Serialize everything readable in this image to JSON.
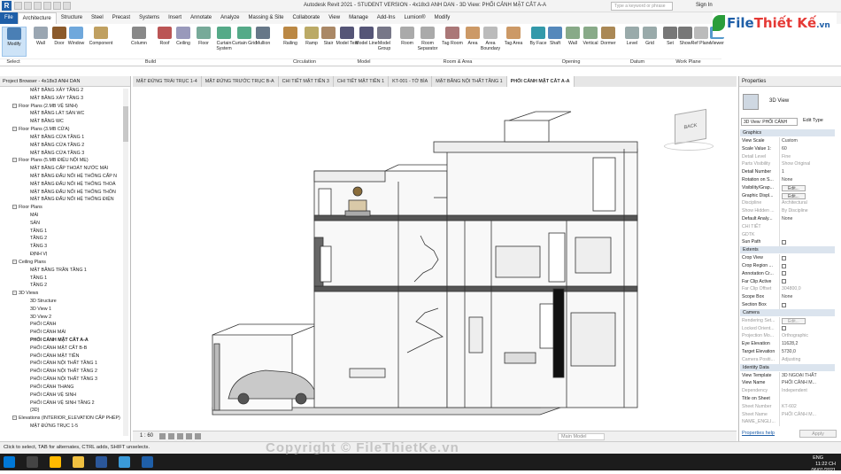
{
  "app": {
    "title": "Autodesk Revit 2021 - STUDENT VERSION - 4x18x3 ANH DAN - 3D View: PHỐI CẢNH MẶT CẮT A-A",
    "search_placeholder": "Type a keyword or phrase",
    "sign_in": "Sign In"
  },
  "ribbon_tabs": [
    "File",
    "Architecture",
    "Structure",
    "Steel",
    "Precast",
    "Systems",
    "Insert",
    "Annotate",
    "Analyze",
    "Massing & Site",
    "Collaborate",
    "View",
    "Manage",
    "Add-Ins",
    "Lumion®",
    "Modify"
  ],
  "ribbon_buttons": [
    "Modify",
    "Wall",
    "Door",
    "Window",
    "Component",
    "Column",
    "Roof",
    "Ceiling",
    "Floor",
    "Curtain System",
    "Curtain Grid",
    "Mullion",
    "Railing",
    "Ramp",
    "Stair",
    "Model Text",
    "Model Line",
    "Model Group",
    "Room",
    "Room Separator",
    "Tag Room",
    "Area",
    "Area Boundary",
    "Tag Area",
    "By Face",
    "Shaft",
    "Wall",
    "Vertical",
    "Dormer",
    "Level",
    "Grid",
    "Set",
    "Show",
    "Ref Plane",
    "Viewer"
  ],
  "ribbon_groups": [
    "Select",
    "Build",
    "Circulation",
    "Model",
    "Room & Area",
    "Opening",
    "Datum",
    "Work Plane"
  ],
  "logo": {
    "prefix": "File",
    "suffix": "Thiết Kế",
    "domain": ".vn"
  },
  "project_browser": {
    "title": "Project Browser - 4x18x3 ANH DAN",
    "items": [
      "MẶT BẰNG XÂY TẦNG 2",
      "MẶT BẰNG XÂY TẦNG 3",
      "Floor Plans (2.MB VỆ SINH)",
      "MẶT BẰNG LÁT SÀN WC",
      "MẶT BẰNG WC",
      "Floor Plans (3.MB CỬA)",
      "MẶT BẰNG CỬA TẦNG 1",
      "MẶT BẰNG CỬA TẦNG 2",
      "MẶT BẰNG CỬA TẦNG 3",
      "Floor Plans (5.MB ĐIỆU NỘI MẸ)",
      "MẶT BẰNG CẤP THOÁT NƯỚC MÁI",
      "MẶT BẰNG ĐẤU NỐI HỆ THỐNG CẤP N",
      "MẶT BẰNG ĐẤU NỐI HỆ THỐNG THOÁ",
      "MẶT BẰNG ĐẤU NỐI HỆ THỐNG THÔN",
      "MẶT BẰNG ĐẤU NỐI HỆ THỐNG ĐIỆN",
      "Floor Plans",
      "MÁI",
      "SÂN",
      "TẦNG 1",
      "TẦNG 2",
      "TẦNG 3",
      "ĐỊNH VỊ",
      "Ceiling Plans",
      "MẶT BẰNG TRẦN TẦNG 1",
      "TẦNG 1",
      "TẦNG 2",
      "3D Views",
      "3D Structure",
      "3D View 1",
      "3D View 2",
      "PHỐI CẢNH",
      "PHỐI CẢNH MÁI",
      "PHỐI CẢNH MẶT CẮT A-A",
      "PHỐI CẢNH MẶT CẮT B-B",
      "PHỐI CẢNH MẶT TIỀN",
      "PHỐI CẢNH NỘI THẤT TẦNG 1",
      "PHỐI CẢNH NỘI THẤT TẦNG 2",
      "PHỐI CẢNH NỘI THẤT TẦNG 3",
      "PHỐI CẢNH THANG",
      "PHỐI CẢNH VỆ SINH",
      "PHỐI CẢNH VỆ SINH TẦNG 2",
      "{3D}",
      "Elevations (INTERIOR_ELEVATION CẤP PHÉP)",
      "MẶT ĐỨNG TRỤC 1-5"
    ]
  },
  "view_tabs": [
    "MẶT ĐỨNG TRÁI TRỤC 1-4",
    "MẶT ĐỨNG TRƯỚC TRỤC B-A",
    "CHI TIẾT MẶT TIỀN 3",
    "CHI TIẾT MẶT TIỀN 1",
    "KT-001 - TỜ BÌA",
    "MẶT BẰNG NỘI THẤT TẦNG 1",
    "PHỐI CẢNH MẶT CẮT A-A"
  ],
  "viewcube_label": "BACK",
  "view_control": {
    "scale": "1 : 60",
    "model": "Main Model"
  },
  "properties": {
    "title": "Properties",
    "type": "3D View",
    "selector": "3D View: PHỐI CẢNH",
    "edit_type": "Edit Type",
    "sections": [
      "Graphics",
      "Extents",
      "Camera",
      "Identity Data"
    ],
    "graphics": [
      [
        "View Scale",
        "Custom"
      ],
      [
        "Scale Value  1:",
        "60"
      ],
      [
        "Detail Level",
        "Fine"
      ],
      [
        "Parts Visibility",
        "Show Original"
      ],
      [
        "Detail Number",
        "1"
      ],
      [
        "Rotation on S...",
        "None"
      ],
      [
        "Visibility/Grap...",
        "Edit..."
      ],
      [
        "Graphic Displ...",
        "Edit..."
      ],
      [
        "Discipline",
        "Architectural"
      ],
      [
        "Show Hidden ...",
        "By Discipline"
      ],
      [
        "Default Analy...",
        "None"
      ],
      [
        "CHI TIẾT",
        ""
      ],
      [
        "GDTK",
        ""
      ],
      [
        "Sun Path",
        ""
      ]
    ],
    "extents": [
      [
        "Crop View",
        ""
      ],
      [
        "Crop Region ...",
        ""
      ],
      [
        "Annotation Cr...",
        ""
      ],
      [
        "Far Clip Active",
        ""
      ],
      [
        "Far Clip Offset",
        "304800,0"
      ],
      [
        "Scope Box",
        "None"
      ],
      [
        "Section Box",
        ""
      ]
    ],
    "camera": [
      [
        "Rendering Set...",
        "Edit..."
      ],
      [
        "Locked Orient...",
        ""
      ],
      [
        "Projection Mo...",
        "Orthographic"
      ],
      [
        "Eye Elevation",
        "11628,2"
      ],
      [
        "Target Elevation",
        "5730,0"
      ],
      [
        "Camera Positi...",
        "Adjusting"
      ]
    ],
    "identity": [
      [
        "View Template",
        "3D NGOẠI THẤT"
      ],
      [
        "View Name",
        "PHỐI CẢNH M..."
      ],
      [
        "Dependency",
        "Independent"
      ],
      [
        "Title on Sheet",
        ""
      ],
      [
        "Sheet Number",
        "KT-602"
      ],
      [
        "Sheet Name",
        "PHỐI CẢNH M..."
      ],
      [
        "NAME_ENGLI...",
        ""
      ]
    ],
    "help": "Properties help",
    "apply": "Apply"
  },
  "status": "Click to select, TAB for alternates, CTRL adds, SHIFT unselects.",
  "clock": {
    "time": "11:22 CH",
    "date": "06/01/2021",
    "lang": "ENG"
  },
  "watermark": "Copyright © FileThietKe.vn",
  "colors": {
    "file_tab": "#1f5fa8",
    "taskbar": "#1c1c1c",
    "section_bg": "#dbe4ee"
  }
}
